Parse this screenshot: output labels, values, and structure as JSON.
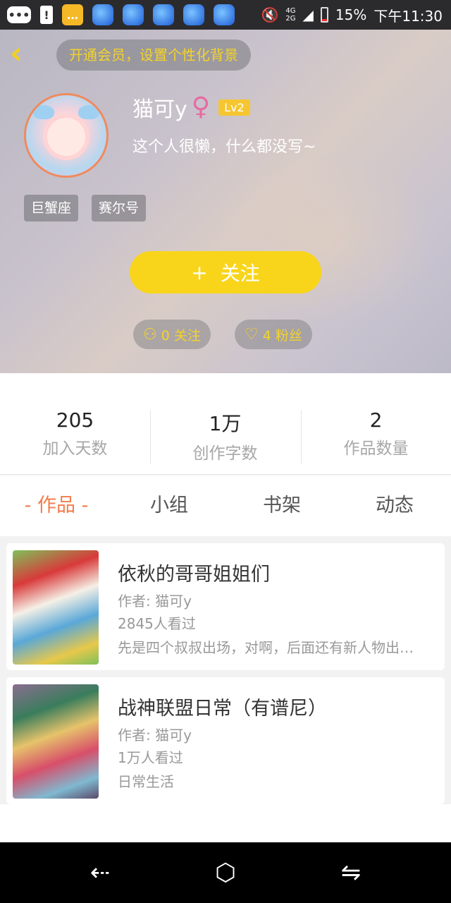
{
  "status_bar": {
    "network": "4G\n2G",
    "battery": "15%",
    "time": "下午11:30"
  },
  "header": {
    "back_icon": "chevron-left-icon",
    "vip_banner": "开通会员，设置个性化背景",
    "username": "猫可y",
    "gender_icon": "♀",
    "level": "Lv2",
    "signature": "这个人很懒，什么都没写~",
    "tags": [
      "巨蟹座",
      "赛尔号"
    ],
    "follow_plus": "+",
    "follow_label": "关注",
    "following": "0 关注",
    "fans": "4 粉丝",
    "accent_color": "#f8d51b"
  },
  "stats": [
    {
      "value": "205",
      "label": "加入天数"
    },
    {
      "value": "1万",
      "label": "创作字数"
    },
    {
      "value": "2",
      "label": "作品数量"
    }
  ],
  "tabs": [
    "- 作品 -",
    "小组",
    "书架",
    "动态"
  ],
  "works": [
    {
      "title": "依秋的哥哥姐姐们",
      "author": "作者: 猫可y",
      "views": "2845人看过",
      "desc": "先是四个叔叔出场，对啊，后面还有新人物出…"
    },
    {
      "title": "战神联盟日常（有谱尼）",
      "author": "作者: 猫可y",
      "views": "1万人看过",
      "desc": "日常生活"
    }
  ],
  "navbar": {
    "back": "⇠",
    "home": "⬡",
    "recent": "⇋"
  }
}
